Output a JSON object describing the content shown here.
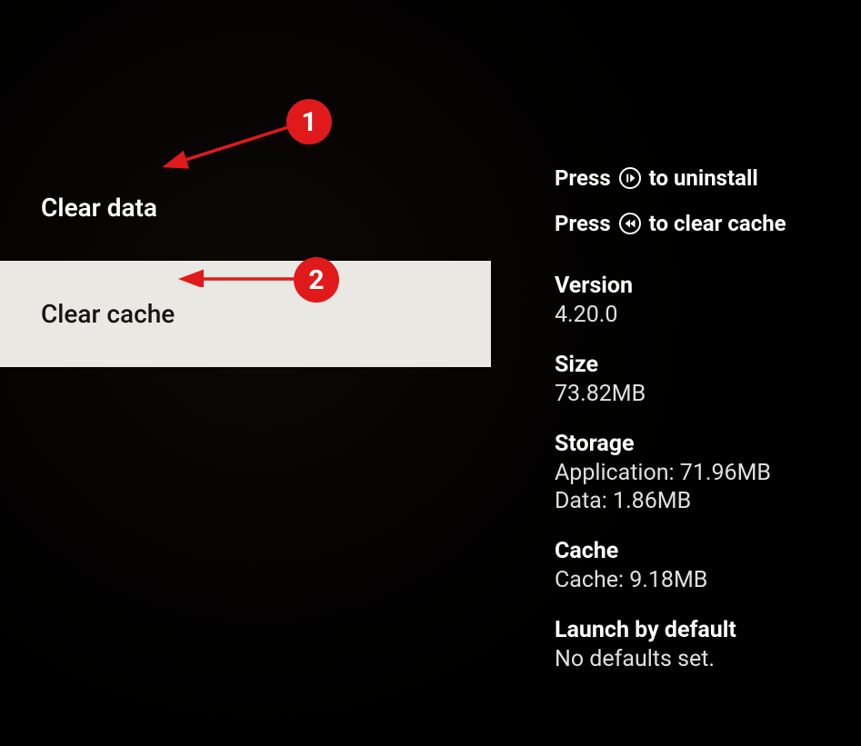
{
  "menu": {
    "clear_data_label": "Clear data",
    "clear_cache_label": "Clear cache"
  },
  "hints": {
    "press_prefix": "Press",
    "uninstall_suffix": "to uninstall",
    "clear_cache_suffix": "to clear cache"
  },
  "info": {
    "version_label": "Version",
    "version_value": "4.20.0",
    "size_label": "Size",
    "size_value": "73.82MB",
    "storage_label": "Storage",
    "storage_application": "Application: 71.96MB",
    "storage_data": "Data: 1.86MB",
    "cache_label": "Cache",
    "cache_value": "Cache: 9.18MB",
    "launch_label": "Launch by default",
    "launch_value": "No defaults set."
  },
  "annotations": {
    "badge_1": "1",
    "badge_2": "2"
  }
}
